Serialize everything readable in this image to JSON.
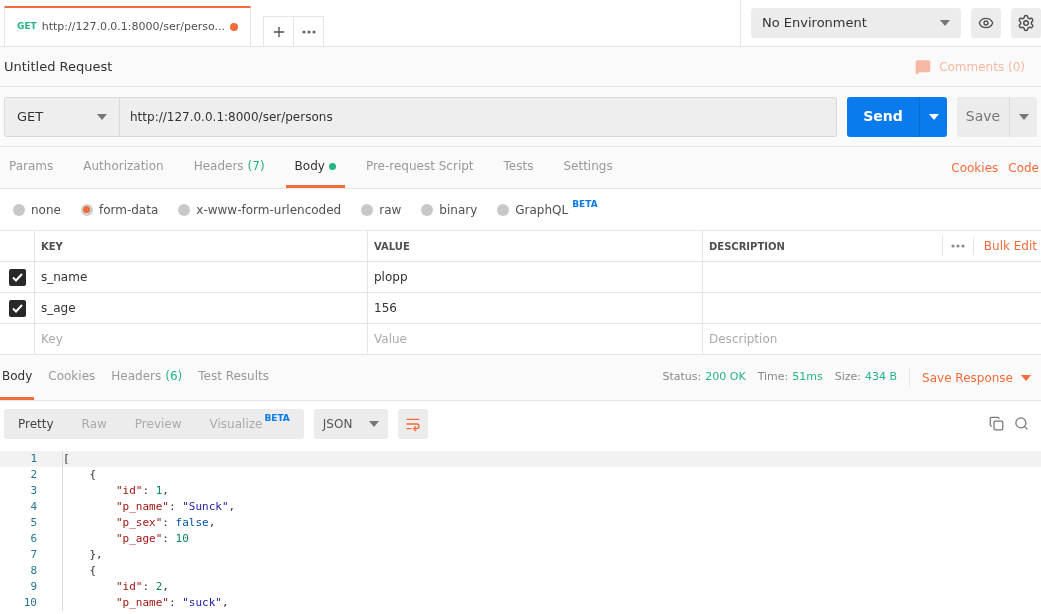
{
  "request_tab": {
    "method": "GET",
    "title": "http://127.0.0.1:8000/ser/perso...",
    "unsaved": true,
    "selected": true
  },
  "environment": {
    "value": "No Environment"
  },
  "request_title": "Untitled Request",
  "comments": "Comments (0)",
  "url_bar": {
    "method": "GET",
    "url": "http://127.0.0.1:8000/ser/persons"
  },
  "send_button": "Send",
  "save_button": "Save",
  "request_tabs": [
    {
      "label": "Params",
      "selected": false
    },
    {
      "label": "Authorization",
      "selected": false
    },
    {
      "label": "Headers",
      "count": "(7)",
      "selected": false
    },
    {
      "label": "Body",
      "selected": true,
      "dot": true
    },
    {
      "label": "Pre-request Script",
      "selected": false
    },
    {
      "label": "Tests",
      "selected": false
    },
    {
      "label": "Settings",
      "selected": false
    }
  ],
  "request_links": [
    "Cookies",
    "Code"
  ],
  "body_types": [
    {
      "label": "none",
      "selected": false
    },
    {
      "label": "form-data",
      "selected": true
    },
    {
      "label": "x-www-form-urlencoded",
      "selected": false
    },
    {
      "label": "raw",
      "selected": false
    },
    {
      "label": "binary",
      "selected": false
    },
    {
      "label": "GraphQL",
      "badge": "BETA",
      "selected": false
    }
  ],
  "form_table": {
    "columns": [
      "KEY",
      "VALUE",
      "DESCRIPTION"
    ],
    "bulk_edit": "Bulk Edit",
    "rows": [
      {
        "checked": true,
        "key": "s_name",
        "value": "plopp"
      },
      {
        "checked": true,
        "key": "s_age",
        "value": "156"
      }
    ],
    "new_row": {
      "key_placeholder": "Key",
      "value_placeholder": "Value",
      "description_placeholder": "Description"
    }
  },
  "response_tabs": [
    {
      "label": "Body",
      "selected": true
    },
    {
      "label": "Cookies",
      "selected": false
    },
    {
      "label": "Headers",
      "count": "(6)",
      "selected": false
    },
    {
      "label": "Test Results",
      "selected": false
    }
  ],
  "response_meta": [
    {
      "label": "Status:",
      "value": "200 OK"
    },
    {
      "label": "Time:",
      "value": "51ms"
    },
    {
      "label": "Size:",
      "value": "434 B"
    }
  ],
  "save_response": "Save Response",
  "view_modes": [
    {
      "label": "Pretty",
      "selected": true
    },
    {
      "label": "Raw",
      "selected": false
    },
    {
      "label": "Preview",
      "selected": false
    },
    {
      "label": "Visualize",
      "badge": "BETA",
      "selected": false
    }
  ],
  "format": "JSON",
  "code_lines": [
    {
      "number": "1",
      "tokens": [
        {
          "kind": "punct",
          "text": "["
        }
      ]
    },
    {
      "number": "2",
      "tokens": [
        {
          "kind": "punct",
          "text": "    {"
        }
      ]
    },
    {
      "number": "3",
      "tokens": [
        {
          "kind": "key",
          "text": "        \"id\""
        },
        {
          "kind": "punct",
          "text": ": "
        },
        {
          "kind": "number",
          "text": "1"
        },
        {
          "kind": "punct",
          "text": ","
        }
      ]
    },
    {
      "number": "4",
      "tokens": [
        {
          "kind": "key",
          "text": "        \"p_name\""
        },
        {
          "kind": "punct",
          "text": ": "
        },
        {
          "kind": "string",
          "text": "\"Sunck\""
        },
        {
          "kind": "punct",
          "text": ","
        }
      ]
    },
    {
      "number": "5",
      "tokens": [
        {
          "kind": "key",
          "text": "        \"p_sex\""
        },
        {
          "kind": "punct",
          "text": ": "
        },
        {
          "kind": "bool",
          "text": "false"
        },
        {
          "kind": "punct",
          "text": ","
        }
      ]
    },
    {
      "number": "6",
      "tokens": [
        {
          "kind": "key",
          "text": "        \"p_age\""
        },
        {
          "kind": "punct",
          "text": ": "
        },
        {
          "kind": "number",
          "text": "10"
        }
      ]
    },
    {
      "number": "7",
      "tokens": [
        {
          "kind": "punct",
          "text": "    },"
        }
      ]
    },
    {
      "number": "8",
      "tokens": [
        {
          "kind": "punct",
          "text": "    {"
        }
      ]
    },
    {
      "number": "9",
      "tokens": [
        {
          "kind": "key",
          "text": "        \"id\""
        },
        {
          "kind": "punct",
          "text": ": "
        },
        {
          "kind": "number",
          "text": "2"
        },
        {
          "kind": "punct",
          "text": ","
        }
      ]
    },
    {
      "number": "10",
      "tokens": [
        {
          "kind": "key",
          "text": "        \"p_name\""
        },
        {
          "kind": "punct",
          "text": ": "
        },
        {
          "kind": "string",
          "text": "\"suck\""
        },
        {
          "kind": "punct",
          "text": ","
        }
      ]
    }
  ]
}
